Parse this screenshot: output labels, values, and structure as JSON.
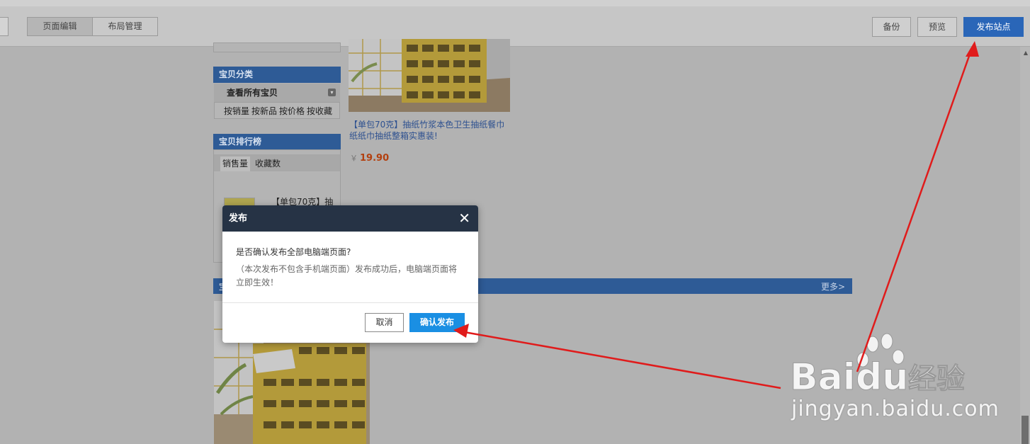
{
  "toolbar": {
    "tabs": [
      {
        "label": "页面编辑",
        "active": true
      },
      {
        "label": "布局管理",
        "active": false
      }
    ],
    "backup_label": "备份",
    "preview_label": "预览",
    "publish_label": "发布站点"
  },
  "sidebar": {
    "category_title": "宝贝分类",
    "all_items": "查看所有宝贝",
    "sort_links": [
      "按销量",
      "按新品",
      "按价格",
      "按收藏"
    ],
    "ranking_title": "宝贝排行榜",
    "ranking_tabs": [
      "销售量",
      "收藏数"
    ],
    "ranking_item": "【单包70克】抽"
  },
  "product": {
    "title": "【单包70克】抽纸竹浆本色卫生抽纸餐巾纸纸巾抽纸整箱实惠装!",
    "currency": "￥",
    "price": "19.90"
  },
  "section": {
    "left_text": "宝",
    "more_label": "更多>"
  },
  "dialog": {
    "title": "发布",
    "question": "是否确认发布全部电脑端页面?",
    "note": "（本次发布不包含手机端页面）发布成功后，电脑端页面将立即生效！",
    "cancel_label": "取消",
    "confirm_label": "确认发布"
  },
  "watermark": {
    "brand": "Baidu经验",
    "url": "jingyan.baidu.com"
  },
  "colors": {
    "toolbar_bg": "#c6c6c6",
    "publish_btn": "#2a66b8",
    "panel_head": "#2e5b96",
    "dialog_head": "#263345",
    "confirm_btn": "#1a8fe3",
    "annotation_arrow": "#e01b1b"
  }
}
